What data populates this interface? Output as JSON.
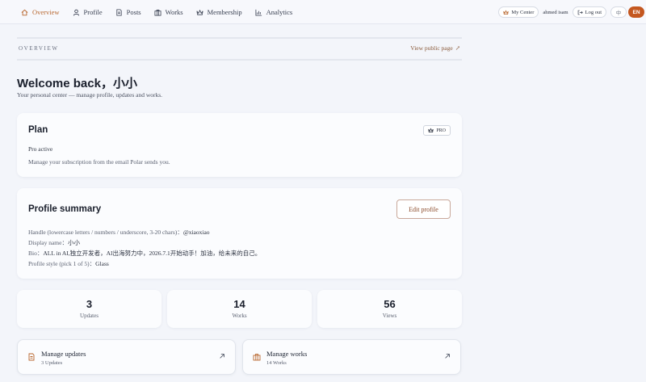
{
  "nav": {
    "items": [
      {
        "label": "Overview",
        "icon": "home-icon",
        "active": true
      },
      {
        "label": "Profile",
        "icon": "user-icon",
        "active": false
      },
      {
        "label": "Posts",
        "icon": "document-icon",
        "active": false
      },
      {
        "label": "Works",
        "icon": "briefcase-icon",
        "active": false
      },
      {
        "label": "Membership",
        "icon": "crown-icon",
        "active": false
      },
      {
        "label": "Analytics",
        "icon": "chart-icon",
        "active": false
      }
    ]
  },
  "header": {
    "my_center": "My Center",
    "user_name": "ahmed isam",
    "logout": "Log out",
    "lang_zh": "中",
    "lang_en": "EN"
  },
  "overview": {
    "label": "OVERVIEW",
    "public_link": "View public page",
    "public_arrow": "↗"
  },
  "welcome": {
    "title": "Welcome back，小小",
    "subtitle": "Your personal center — manage profile, updates and works."
  },
  "plan": {
    "title": "Plan",
    "badge": "PRO",
    "status": "Pro active",
    "note": "Manage your subscription from the email Polar sends you."
  },
  "profile": {
    "title": "Profile summary",
    "edit_label": "Edit profile",
    "fields": [
      {
        "label": "Handle (lowercase letters / numbers / underscore, 3-20 chars)：",
        "value": "@xiaoxiao"
      },
      {
        "label": "Display name：",
        "value": "小小"
      },
      {
        "label": "Bio：",
        "value": "ALL in AI,独立开发者，AI出海努力中，2026.7.1开始动手！加油，给未来的自己。"
      },
      {
        "label": "Profile style (pick 1 of 5)：",
        "value": "Glass"
      }
    ]
  },
  "stats": [
    {
      "value": "3",
      "label": "Updates"
    },
    {
      "value": "14",
      "label": "Works"
    },
    {
      "value": "56",
      "label": "Views"
    }
  ],
  "manage": [
    {
      "title": "Manage updates",
      "sub": "3 Updates",
      "icon": "document-icon"
    },
    {
      "title": "Manage works",
      "sub": "14 Works",
      "icon": "briefcase-icon"
    }
  ],
  "colors": {
    "accent": "#b8662d",
    "lang_active": "#c4571f",
    "background": "#f3f5fa"
  }
}
